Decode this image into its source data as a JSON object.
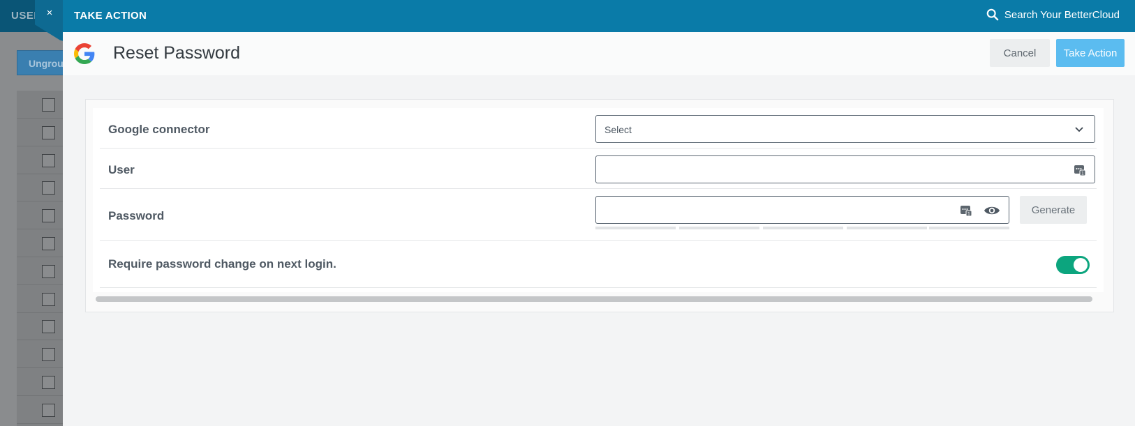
{
  "background": {
    "title": "USER",
    "button_label": "Ungrou",
    "checkbox_count": 12
  },
  "topbar": {
    "title": "TAKE ACTION",
    "search_label": "Search Your BetterCloud",
    "color": "#0a7ba8"
  },
  "close": {
    "label": "×"
  },
  "header": {
    "title": "Reset Password",
    "cancel_label": "Cancel",
    "take_action_label": "Take Action",
    "take_action_color": "#5bbcf0"
  },
  "form": {
    "connector": {
      "label": "Google connector",
      "value": "Select"
    },
    "user": {
      "label": "User",
      "value": "",
      "icon": "vault-icon"
    },
    "password": {
      "label": "Password",
      "value": "",
      "generate_label": "Generate",
      "strength_segments": 5,
      "strength_level": 0
    },
    "require_change": {
      "label": "Require password change on next login.",
      "enabled": true,
      "toggle_color": "#0ca57e"
    }
  }
}
